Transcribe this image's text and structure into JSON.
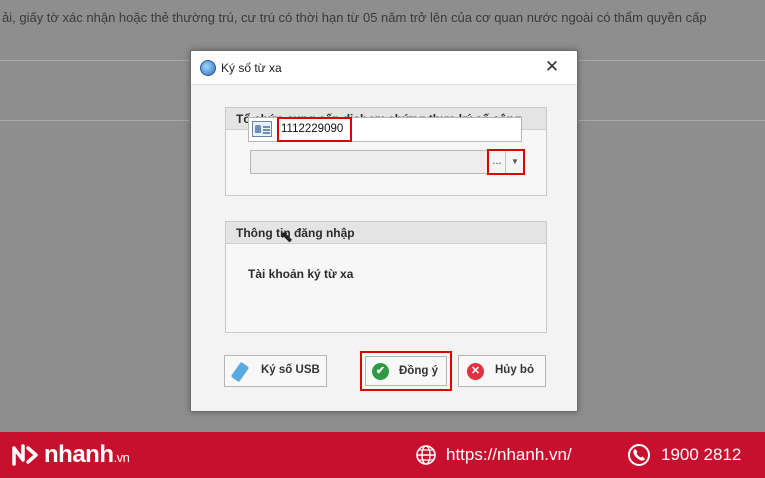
{
  "background": {
    "text": "ải, giấy tờ xác nhận hoặc thẻ thường trú, cư trú có thời hạn từ 05 năm trở lên của cơ quan nước ngoài có thẩm quyền cấp"
  },
  "dialog": {
    "title": "Ký số từ xa",
    "close_glyph": "✕",
    "provider_group": {
      "header": "Tổ chức cung cấp dịch vụ chứng thực ký số cộng",
      "select_value": "",
      "browse_label": "...",
      "dropdown_glyph": "▼"
    },
    "login_group": {
      "header": "Thông tin đăng nhập",
      "account_label": "Tài khoản ký từ xa",
      "account_value": "1112229090"
    },
    "buttons": {
      "usb_label": "Ký số USB",
      "ok_label": "Đồng ý",
      "ok_glyph": "✔",
      "cancel_label": "Hủy bỏ",
      "cancel_glyph": "✕"
    }
  },
  "footer": {
    "brand": "nhanh",
    "brand_suffix": ".vn",
    "website": "https://nhanh.vn/",
    "hotline": "1900 2812"
  },
  "colors": {
    "highlight_red": "#e00000",
    "footer_red": "#c8102e",
    "ok_green": "#2e9a45"
  }
}
